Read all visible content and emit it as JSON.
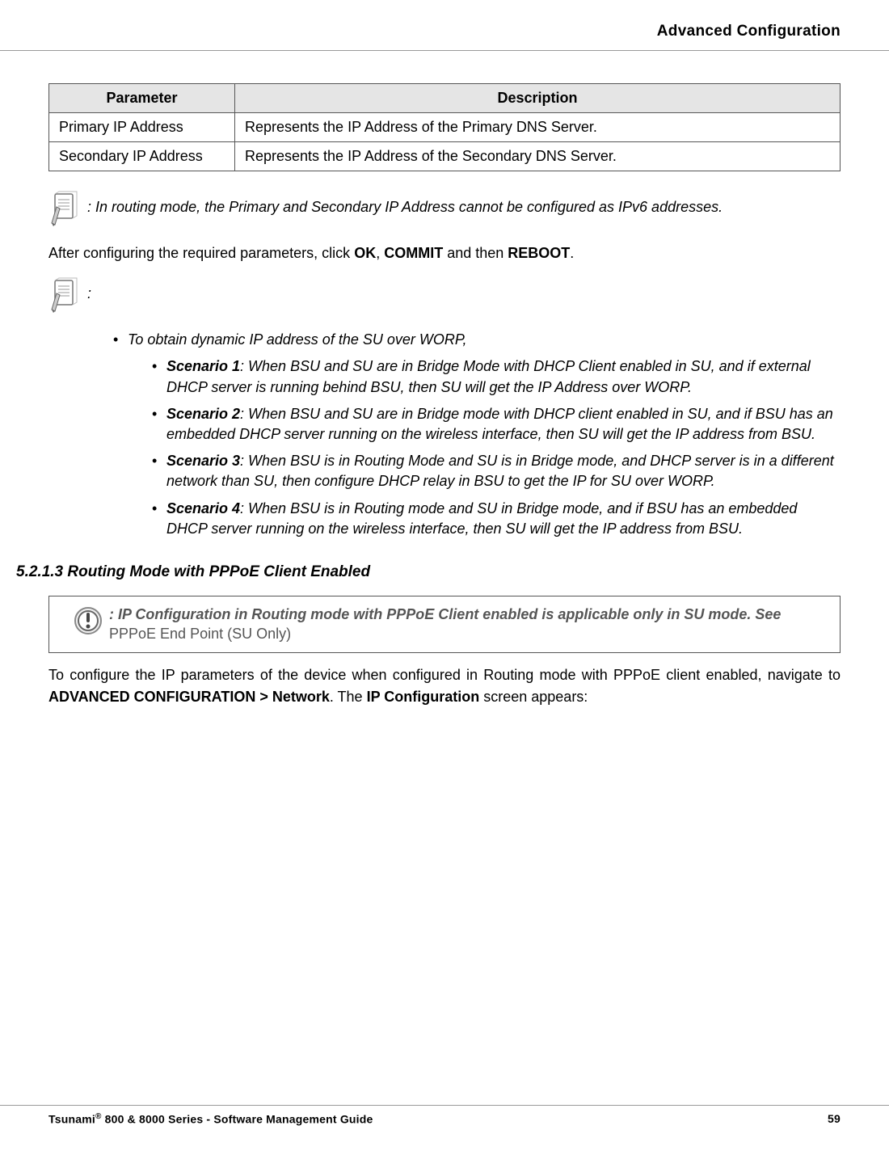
{
  "header": {
    "title": "Advanced Configuration"
  },
  "table": {
    "headers": {
      "param": "Parameter",
      "desc": "Description"
    },
    "rows": [
      {
        "param": "Primary IP Address",
        "desc": "Represents the IP Address of the Primary DNS Server."
      },
      {
        "param": "Secondary IP Address",
        "desc": "Represents the IP Address of the Secondary DNS Server."
      }
    ]
  },
  "note1": ": In routing mode, the Primary and Secondary IP Address cannot be configured as IPv6 addresses.",
  "after_note1_pre": "After configuring the required parameters, click ",
  "after_note1_ok": "OK",
  "after_note1_sep": ", ",
  "after_note1_commit": "COMMIT",
  "after_note1_mid": " and then ",
  "after_note1_reboot": "REBOOT",
  "after_note1_end": ".",
  "note2": ":",
  "scenarios": {
    "lead": "To obtain dynamic IP address of the SU over WORP,",
    "items": [
      {
        "label": "Scenario 1",
        "text": ": When BSU and SU are in Bridge Mode with DHCP Client enabled in SU, and if external DHCP server is running behind BSU, then SU will get the IP Address over WORP."
      },
      {
        "label": "Scenario 2",
        "text": ": When BSU and SU are in Bridge mode with DHCP client enabled in SU, and if BSU has an embedded DHCP server running on the wireless interface, then SU will get the IP address from BSU."
      },
      {
        "label": "Scenario 3",
        "text": ": When BSU is in Routing Mode and SU is in Bridge mode, and DHCP server is in a different network than SU, then configure DHCP relay in BSU to get the IP for SU over WORP."
      },
      {
        "label": "Scenario 4",
        "text": ": When BSU is in Routing mode and SU in Bridge mode, and if BSU has an embedded DHCP server running on the wireless interface, then SU will get the IP address from BSU."
      }
    ]
  },
  "subheading": "5.2.1.3 Routing Mode with PPPoE Client Enabled",
  "caution": {
    "lead": ": IP Configuration in Routing mode with PPPoE Client enabled is applicable only in SU mode. See ",
    "link": "PPPoE End Point (SU Only)"
  },
  "after_box": {
    "pre": "To configure the IP parameters of the device when configured in Routing mode with PPPoE client enabled, navigate to ",
    "bold1": "ADVANCED CONFIGURATION > Network",
    "mid": ". The ",
    "bold2": "IP Configuration",
    "end": " screen appears:"
  },
  "footer": {
    "left_pre": "Tsunami",
    "left_reg": "®",
    "left_post": " 800 & 8000 Series - Software Management Guide",
    "right": "59"
  }
}
